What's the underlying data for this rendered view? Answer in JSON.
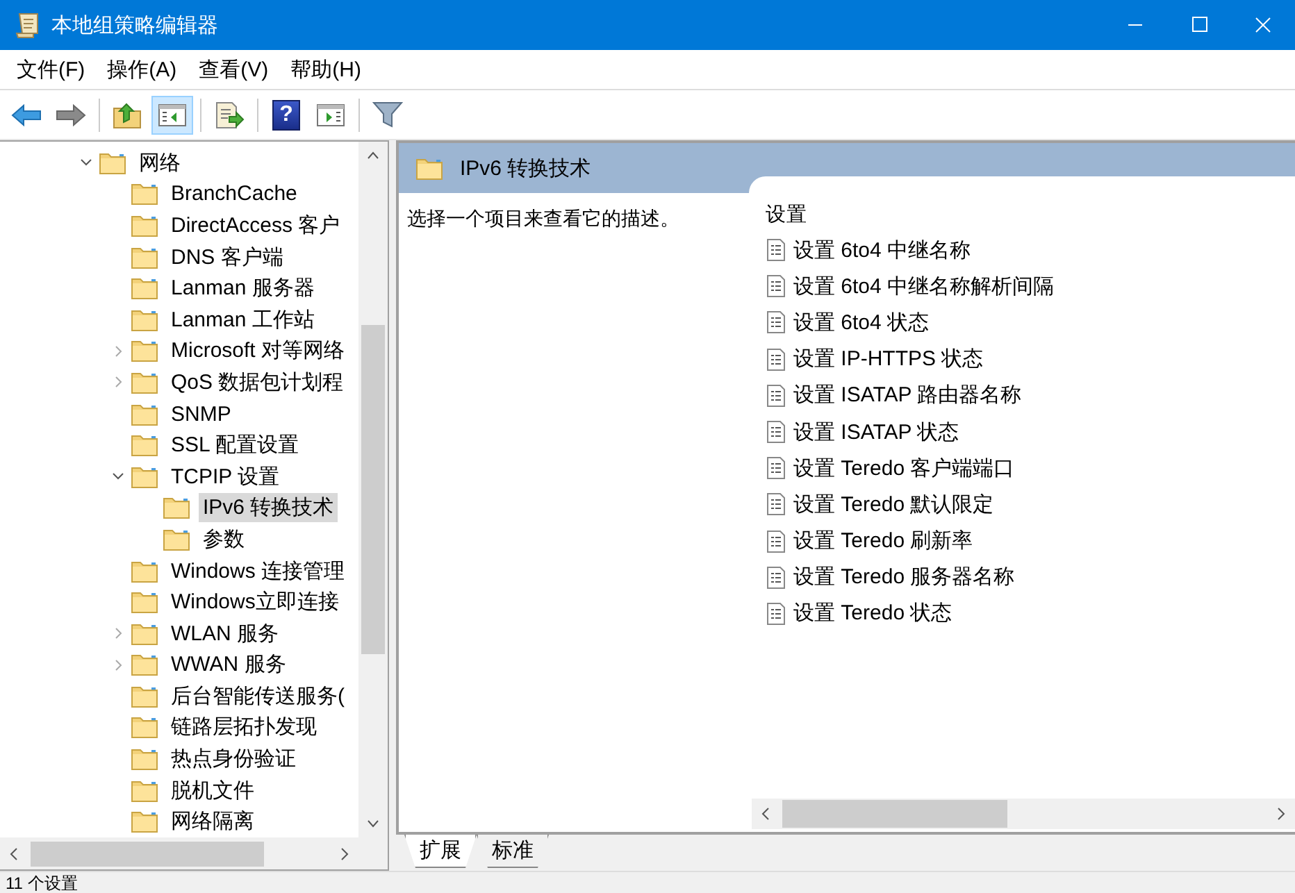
{
  "window": {
    "title": "本地组策略编辑器"
  },
  "menu": [
    "文件(F)",
    "操作(A)",
    "查看(V)",
    "帮助(H)"
  ],
  "toolbar": [
    {
      "kind": "back",
      "pressed": false
    },
    {
      "kind": "forward",
      "pressed": false
    },
    {
      "kind": "separator"
    },
    {
      "kind": "up",
      "pressed": false
    },
    {
      "kind": "console-tree",
      "pressed": true
    },
    {
      "kind": "separator"
    },
    {
      "kind": "export",
      "pressed": false
    },
    {
      "kind": "separator"
    },
    {
      "kind": "help",
      "label": "?",
      "pressed": false
    },
    {
      "kind": "action-pane",
      "pressed": false
    },
    {
      "kind": "separator"
    },
    {
      "kind": "filter",
      "pressed": false
    }
  ],
  "tree": [
    {
      "label": "网络",
      "kind": "branch",
      "expanded": true,
      "selected": false,
      "children": [
        {
          "label": "BranchCache",
          "kind": "leaf",
          "selected": false
        },
        {
          "label": "DirectAccess 客户",
          "kind": "leaf",
          "selected": false
        },
        {
          "label": "DNS 客户端",
          "kind": "leaf",
          "selected": false
        },
        {
          "label": "Lanman 服务器",
          "kind": "leaf",
          "selected": false
        },
        {
          "label": "Lanman 工作站",
          "kind": "leaf",
          "selected": false
        },
        {
          "label": "Microsoft 对等网络",
          "kind": "branch",
          "expanded": false,
          "selected": false
        },
        {
          "label": "QoS 数据包计划程",
          "kind": "branch",
          "expanded": false,
          "selected": false
        },
        {
          "label": "SNMP",
          "kind": "leaf",
          "selected": false
        },
        {
          "label": "SSL 配置设置",
          "kind": "leaf",
          "selected": false
        },
        {
          "label": "TCPIP 设置",
          "kind": "branch",
          "expanded": true,
          "selected": false,
          "children": [
            {
              "label": "IPv6 转换技术",
              "kind": "leaf",
              "selected": true
            },
            {
              "label": "参数",
              "kind": "leaf",
              "selected": false
            }
          ]
        },
        {
          "label": "Windows 连接管理",
          "kind": "leaf",
          "selected": false
        },
        {
          "label": "Windows立即连接",
          "kind": "leaf",
          "selected": false
        },
        {
          "label": "WLAN 服务",
          "kind": "branch",
          "expanded": false,
          "selected": false
        },
        {
          "label": "WWAN 服务",
          "kind": "branch",
          "expanded": false,
          "selected": false
        },
        {
          "label": "后台智能传送服务(",
          "kind": "leaf",
          "selected": false
        },
        {
          "label": "链路层拓扑发现",
          "kind": "leaf",
          "selected": false
        },
        {
          "label": "热点身份验证",
          "kind": "leaf",
          "selected": false
        },
        {
          "label": "脱机文件",
          "kind": "leaf",
          "selected": false
        },
        {
          "label": "网络隔离",
          "kind": "leaf",
          "selected": false
        }
      ]
    }
  ],
  "detail": {
    "title": "IPv6 转换技术",
    "description": "选择一个项目来查看它的描述。",
    "column": "设置",
    "settings": [
      "设置 6to4 中继名称",
      "设置 6to4 中继名称解析间隔",
      "设置 6to4 状态",
      "设置 IP-HTTPS 状态",
      "设置 ISATAP 路由器名称",
      "设置 ISATAP 状态",
      "设置 Teredo 客户端端口",
      "设置 Teredo 默认限定",
      "设置 Teredo 刷新率",
      "设置 Teredo 服务器名称",
      "设置 Teredo 状态"
    ]
  },
  "tabs": [
    {
      "label": "扩展",
      "selected": true
    },
    {
      "label": "标准",
      "selected": false
    }
  ],
  "status_bar": "11 个设置"
}
